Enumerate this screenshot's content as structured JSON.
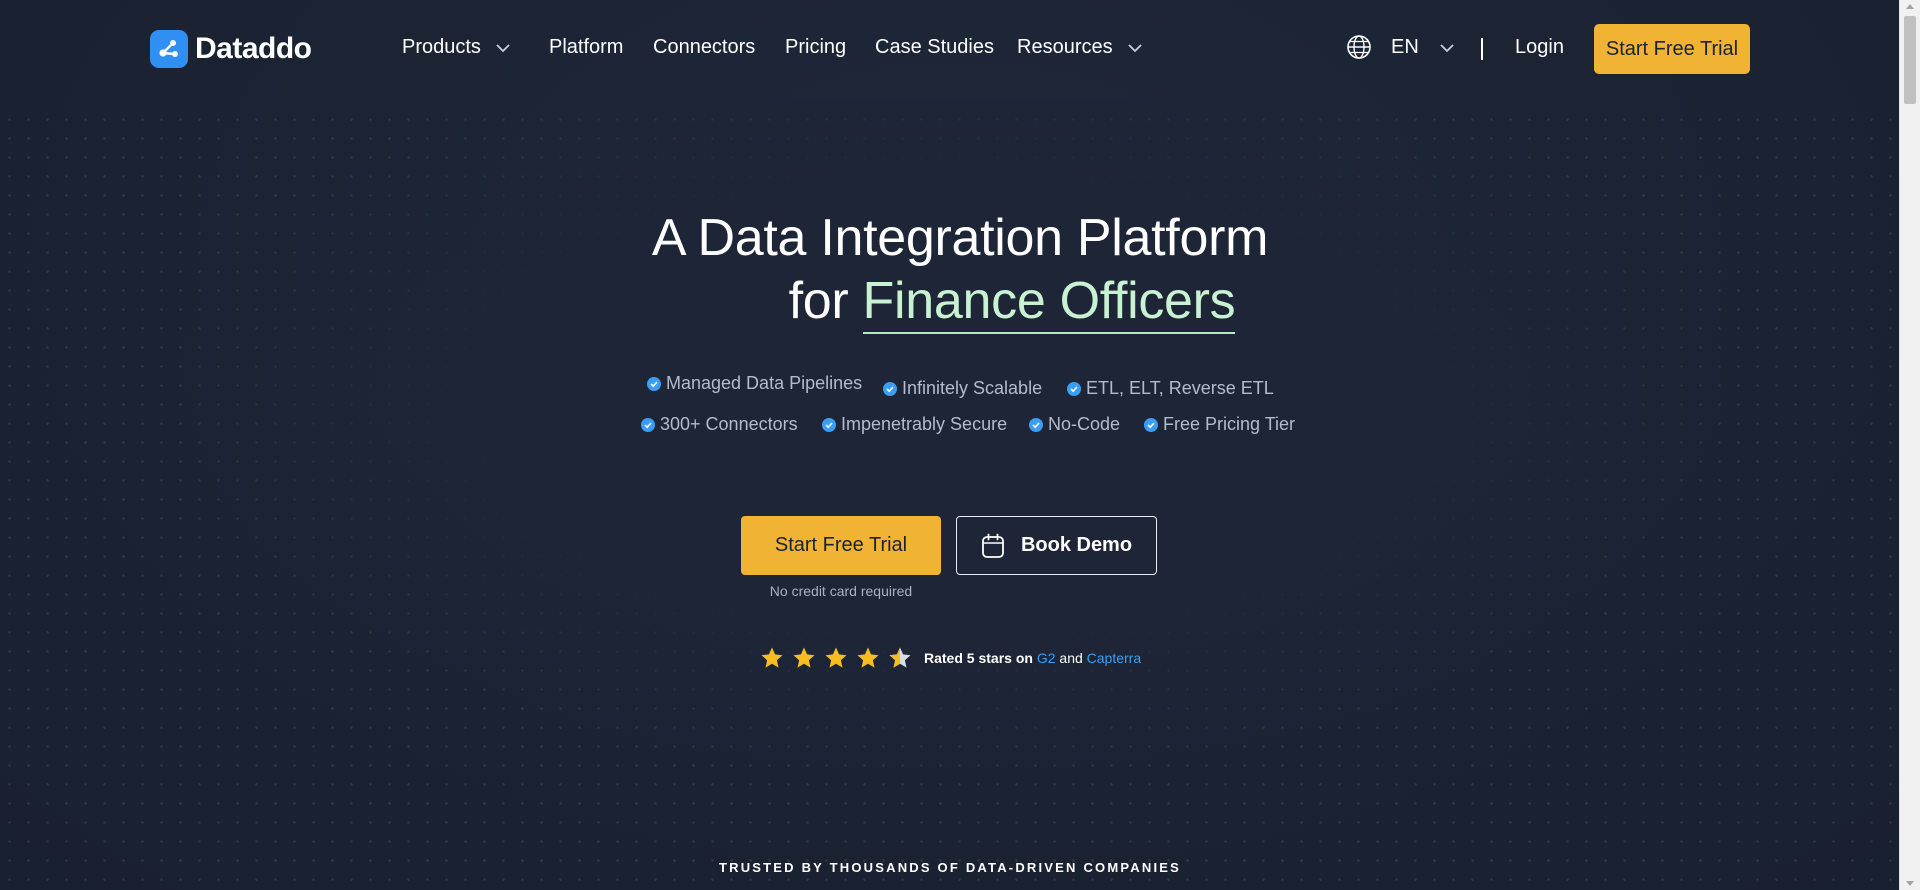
{
  "brand": {
    "name": "Dataddo",
    "logo_icon": "connector-nodes-icon",
    "logo_color": "#2f8ff2"
  },
  "nav": {
    "items": [
      {
        "label": "Products",
        "dropdown": true
      },
      {
        "label": "Platform",
        "dropdown": false
      },
      {
        "label": "Connectors",
        "dropdown": false
      },
      {
        "label": "Pricing",
        "dropdown": false
      },
      {
        "label": "Case Studies",
        "dropdown": false
      },
      {
        "label": "Resources",
        "dropdown": true
      }
    ],
    "language": "EN",
    "language_icon": "globe-icon",
    "login": "Login",
    "cta": "Start Free Trial"
  },
  "hero": {
    "title_line1": "A Data Integration Platform",
    "title_prefix": "for",
    "title_accent": "Finance Officers",
    "features": [
      "Managed Data Pipelines",
      "Infinitely Scalable",
      "ETL, ELT, Reverse ETL",
      "300+ Connectors",
      "Impenetrably Secure",
      "No-Code",
      "Free Pricing Tier"
    ],
    "primary_cta": "Start Free Trial",
    "secondary_cta": "Book Demo",
    "secondary_icon": "calendar-icon",
    "note": "No credit card required",
    "rating": {
      "stars": 5,
      "prefix": "Rated 5 stars on",
      "site1": "G2",
      "joiner": "and",
      "site2": "Capterra"
    }
  },
  "trusted_heading": "TRUSTED BY THOUSANDS OF DATA-DRIVEN COMPANIES",
  "colors": {
    "background": "#1b2333",
    "accent_yellow": "#f0b334",
    "accent_green": "#c9f2d2",
    "link_blue": "#3b9ef5",
    "star": "#f5bd1f"
  }
}
